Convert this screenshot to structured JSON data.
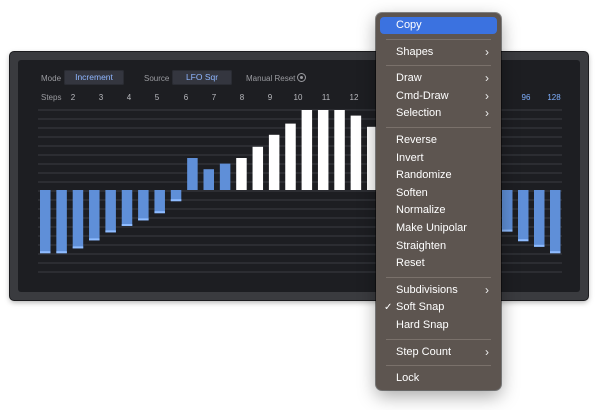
{
  "panel": {
    "mode_label": "Mode",
    "mode_value": "Increment",
    "source_label": "Source",
    "source_value": "LFO Sqr",
    "manual_reset_label": "Manual Reset",
    "steps_label": "Steps",
    "step_counts_left": [
      "2",
      "3",
      "4",
      "5",
      "6",
      "7",
      "8",
      "9",
      "10",
      "11",
      "12"
    ],
    "step_counts_right": [
      "96",
      "128"
    ]
  },
  "chart_data": {
    "type": "bar",
    "values": [
      -0.79,
      -0.79,
      -0.73,
      -0.63,
      -0.53,
      -0.45,
      -0.38,
      -0.29,
      -0.14,
      0.4,
      0.26,
      0.33,
      0.4,
      0.54,
      0.69,
      0.83,
      1.0,
      1.0,
      1.0,
      0.93,
      0.79
    ],
    "right_values": [
      -0.52,
      -0.64,
      -0.71,
      -0.79
    ],
    "ylim": [
      -1,
      1
    ],
    "colors": {
      "positive_active": "#ffffff",
      "positive_dim": "#5f8fd8",
      "negative": "#5f8fd8",
      "grid": "#3a3c42"
    }
  },
  "menu": {
    "items": [
      {
        "label": "Copy",
        "active": true
      },
      {
        "sep": true
      },
      {
        "label": "Shapes",
        "submenu": true
      },
      {
        "sep": true
      },
      {
        "label": "Draw",
        "submenu": true
      },
      {
        "label": "Cmd-Draw",
        "submenu": true
      },
      {
        "label": "Selection",
        "submenu": true
      },
      {
        "sep": true
      },
      {
        "label": "Reverse"
      },
      {
        "label": "Invert"
      },
      {
        "label": "Randomize"
      },
      {
        "label": "Soften"
      },
      {
        "label": "Normalize"
      },
      {
        "label": "Make Unipolar"
      },
      {
        "label": "Straighten"
      },
      {
        "label": "Reset"
      },
      {
        "sep": true
      },
      {
        "label": "Subdivisions",
        "submenu": true
      },
      {
        "label": "Soft Snap",
        "checked": true
      },
      {
        "label": "Hard Snap"
      },
      {
        "sep": true
      },
      {
        "label": "Step Count",
        "submenu": true
      },
      {
        "sep": true
      },
      {
        "label": "Lock"
      }
    ],
    "chevron_glyph": "›",
    "check_glyph": "✓"
  }
}
